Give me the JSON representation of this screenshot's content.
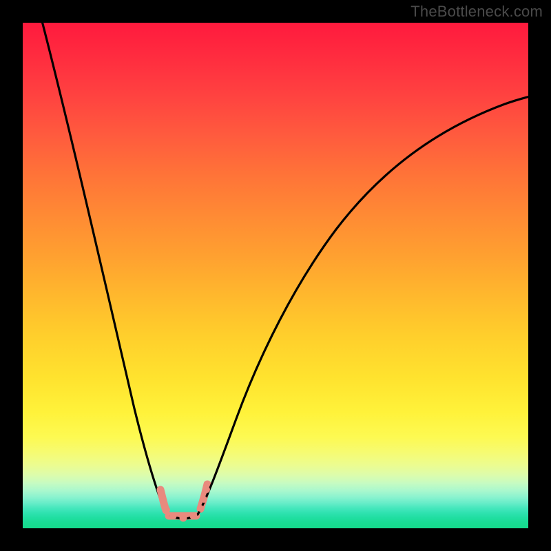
{
  "watermark": "TheBottleneck.com",
  "chart_data": {
    "type": "line",
    "title": "",
    "xlabel": "",
    "ylabel": "",
    "series": [
      {
        "name": "bottleneck-curve",
        "x": [
          0.03,
          0.1,
          0.17,
          0.23,
          0.27,
          0.29,
          0.31,
          0.33,
          0.35,
          0.4,
          0.48,
          0.58,
          0.7,
          0.85,
          1.0
        ],
        "y": [
          1.0,
          0.74,
          0.47,
          0.23,
          0.08,
          0.02,
          0.0,
          0.0,
          0.03,
          0.15,
          0.35,
          0.55,
          0.72,
          0.83,
          0.86
        ]
      }
    ],
    "markers": {
      "name": "trough-beads",
      "x": [
        0.274,
        0.279,
        0.285,
        0.297,
        0.317,
        0.338,
        0.352,
        0.358,
        0.364
      ],
      "y": [
        0.048,
        0.027,
        0.012,
        0.0,
        0.0,
        0.0,
        0.014,
        0.031,
        0.05
      ],
      "color": "#e98a7e"
    },
    "background_gradient_stops": [
      {
        "pos": 0.0,
        "color": "#ff1a3d"
      },
      {
        "pos": 0.3,
        "color": "#ff7338"
      },
      {
        "pos": 0.62,
        "color": "#ffcf2c"
      },
      {
        "pos": 0.82,
        "color": "#fdfa52"
      },
      {
        "pos": 0.93,
        "color": "#8bf3cf"
      },
      {
        "pos": 1.0,
        "color": "#15da8c"
      }
    ],
    "xlim": [
      0,
      1
    ],
    "ylim": [
      0,
      1
    ],
    "grid": false,
    "legend": false
  }
}
